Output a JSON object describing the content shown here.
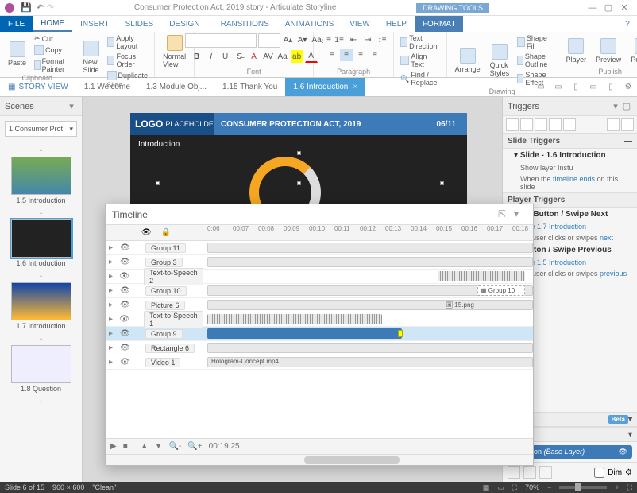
{
  "titlebar": {
    "title": "Consumer Protection Act, 2019.story - Articulate Storyline",
    "context_tool": "DRAWING TOOLS"
  },
  "tabs": {
    "file": "FILE",
    "home": "HOME",
    "insert": "INSERT",
    "slides": "SLIDES",
    "design": "DESIGN",
    "transitions": "TRANSITIONS",
    "animations": "ANIMATIONS",
    "view": "VIEW",
    "help": "HELP",
    "format": "FORMAT"
  },
  "ribbon": {
    "paste": "Paste",
    "cut": "Cut",
    "copy": "Copy",
    "format_painter": "Format Painter",
    "clipboard": "Clipboard",
    "new_slide": "New Slide",
    "apply_layout": "Apply Layout",
    "focus_order": "Focus Order",
    "duplicate": "Duplicate",
    "slide_group": "Slide",
    "normal_view": "Normal View",
    "font_group": "Font",
    "paragraph_group": "Paragraph",
    "drawing_group": "Drawing",
    "text_direction": "Text Direction",
    "align_text": "Align Text",
    "find_replace": "Find / Replace",
    "arrange": "Arrange",
    "quick_styles": "Quick Styles",
    "shape_fill": "Shape Fill",
    "shape_outline": "Shape Outline",
    "shape_effect": "Shape Effect",
    "player": "Player",
    "preview": "Preview",
    "publish": "Publish",
    "publish_group": "Publish"
  },
  "storybar": {
    "story_view": "STORY VIEW",
    "tabs": [
      "1.1 Welcome",
      "1.3 Module Obj...",
      "1.15 Thank You",
      "1.6 Introduction"
    ]
  },
  "scenes": {
    "title": "Scenes",
    "dropdown": "1 Consumer Prot",
    "slides": [
      {
        "label": "1.5 Introduction"
      },
      {
        "label": "1.6 Introduction"
      },
      {
        "label": "1.7 Introduction"
      },
      {
        "label": "1.8 Question"
      }
    ]
  },
  "slide": {
    "logo": "LOGO",
    "placeholder": "PLACEHOLDER",
    "title": "CONSUMER PROTECTION ACT, 2019",
    "page": "06/11",
    "intro": "Introduction"
  },
  "triggers": {
    "title": "Triggers",
    "slide_triggers": "Slide Triggers",
    "slide_item": "Slide - 1.6 Introduction",
    "show_layer": "Show layer Instu",
    "when_timeline": "When the ",
    "timeline_ends": "timeline ends",
    "on_slide": " on this slide",
    "player_triggers": "Player Triggers",
    "next_btn": "Next Button / Swipe Next",
    "jump_next": "slide 1.7 Introduction",
    "when_next": "the user clicks or swipes ",
    "next": "next",
    "prev_btn": "s Button / Swipe Previous",
    "jump_prev": "slide 1.5 Introduction",
    "when_prev": "the user clicks or swipes ",
    "previous": "previous",
    "ts_label": "ts",
    "beta": "Beta",
    "layers_label": "yers",
    "layer_name": "roduction",
    "base_layer": "(Base Layer)",
    "dim": "Dim"
  },
  "timeline": {
    "title": "Timeline",
    "ticks": [
      "0:06",
      "00:07",
      "00:08",
      "00:09",
      "00:10",
      "00:11",
      "00:12",
      "00:13",
      "00:14",
      "00:15",
      "00:16",
      "00:17",
      "00:18"
    ],
    "rows": [
      {
        "name": "Group 11"
      },
      {
        "name": "Group 3"
      },
      {
        "name": "Text-to-Speech 2"
      },
      {
        "name": "Group 10"
      },
      {
        "name": "Picture 6",
        "pic": "15.png"
      },
      {
        "name": "Text-to-Speech 1"
      },
      {
        "name": "Group 9",
        "selected": true
      },
      {
        "name": "Rectangle 6"
      },
      {
        "name": "Video 1",
        "vid": "Hologram-Concept.mp4"
      }
    ],
    "group10_chip": "Group 10",
    "time": "00:19.25"
  },
  "status": {
    "slide": "Slide 6 of 15",
    "dims": "960 × 600",
    "theme": "\"Clean\"",
    "zoom": "70%"
  }
}
